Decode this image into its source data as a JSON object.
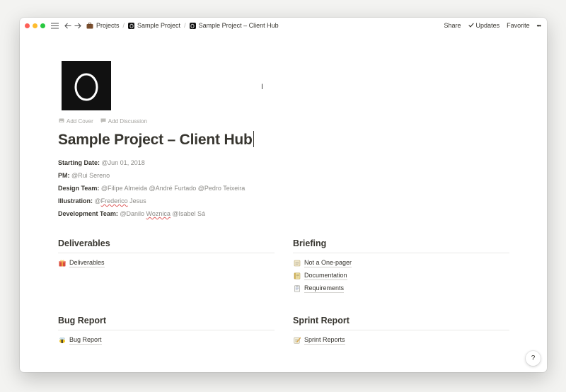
{
  "topbar": {
    "breadcrumbs": [
      {
        "label": "Projects",
        "icon": "briefcase-icon"
      },
      {
        "label": "Sample Project",
        "icon": "egg-logo-icon"
      },
      {
        "label": "Sample Project – Client Hub",
        "icon": "egg-logo-icon"
      }
    ],
    "separator": "/",
    "share": "Share",
    "updates": "Updates",
    "favorite": "Favorite",
    "more": "•••",
    "traffic_colors": [
      "#fe5f57",
      "#febc2e",
      "#28c840"
    ]
  },
  "page": {
    "add_cover": "Add Cover",
    "add_discussion": "Add Discussion",
    "title": "Sample Project – Client Hub"
  },
  "properties": {
    "starting_date": {
      "label": "Starting Date:",
      "value": "@Jun 01, 2018"
    },
    "pm": {
      "label": "PM:",
      "value": "@Rui Sereno"
    },
    "design_team": {
      "label": "Design Team:",
      "value": "@Filipe Almeida @André Furtado @Pedro Teixeira"
    },
    "illustration": {
      "label": "Illustration:",
      "at": "@",
      "name_underlined": "Frederico",
      "rest": " Jesus"
    },
    "development_team": {
      "label": "Development Team:",
      "pre": "@Danilo ",
      "name_underlined": "Woznica",
      "rest": " @Isabel Sá"
    }
  },
  "sections": {
    "deliverables": {
      "heading": "Deliverables",
      "links": [
        {
          "label": "Deliverables",
          "icon": "gift-icon"
        }
      ]
    },
    "briefing": {
      "heading": "Briefing",
      "links": [
        {
          "label": "Not a One-pager",
          "icon": "scroll-icon"
        },
        {
          "label": "Documentation",
          "icon": "ledger-icon"
        },
        {
          "label": "Requirements",
          "icon": "memo-icon"
        }
      ]
    },
    "bug_report": {
      "heading": "Bug Report",
      "links": [
        {
          "label": "Bug Report",
          "icon": "bee-icon"
        }
      ]
    },
    "sprint_report": {
      "heading": "Sprint Report",
      "links": [
        {
          "label": "Sprint Reports",
          "icon": "pencil-memo-icon"
        }
      ]
    }
  },
  "help": "?"
}
